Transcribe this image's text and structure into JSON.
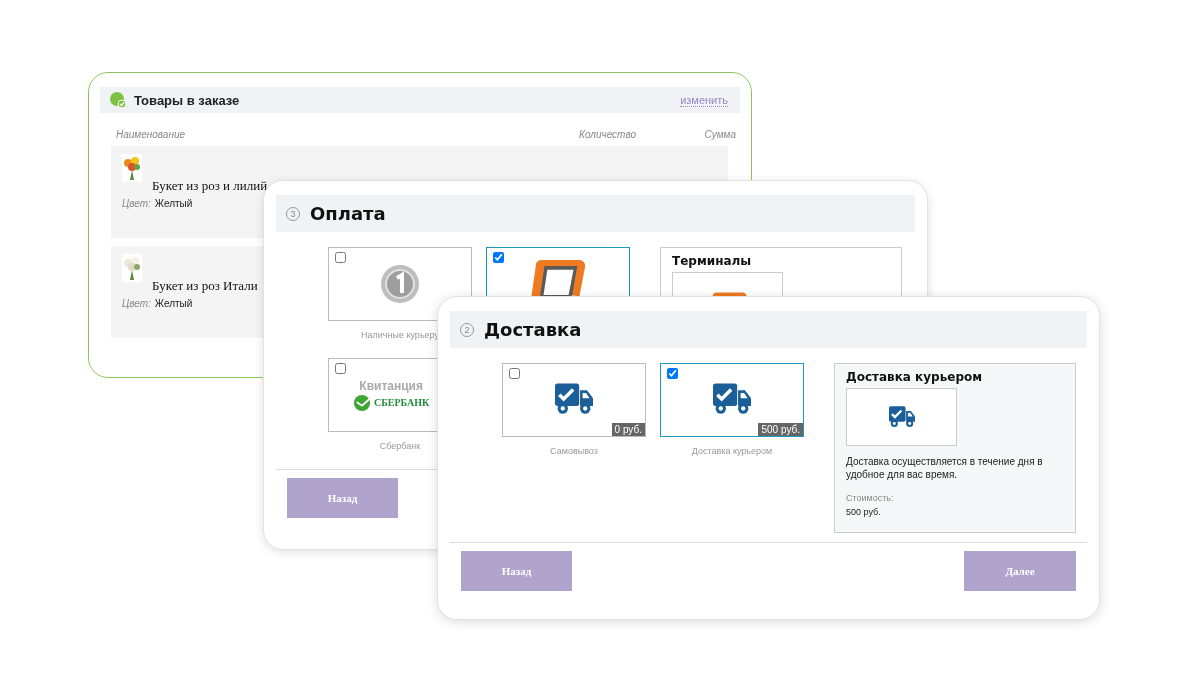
{
  "order_card": {
    "title": "Товары в заказе",
    "edit_link": "изменить",
    "columns": [
      "Наименование",
      "Количество",
      "Сумма"
    ],
    "items": [
      {
        "name": "Букет из роз и лилий",
        "color_label": "Цвет:",
        "color_value": "Желтый",
        "kind": "mixed"
      },
      {
        "name": "Букет из роз Итали",
        "color_label": "Цвет:",
        "color_value": "Желтый",
        "kind": "white"
      }
    ]
  },
  "payment_card": {
    "step": "3",
    "title": "Оплата",
    "options": [
      {
        "kind": "coin",
        "label": "Наличные курьеру",
        "checked": false
      },
      {
        "kind": "terminal",
        "checked": true
      },
      {
        "kind": "sberbank",
        "label": "Сбербанк",
        "checked": false,
        "logo_caption": "Квитанция",
        "logo_text": "СБЕРБАНК"
      }
    ],
    "details": {
      "title": "Терминалы"
    },
    "back_button": "Назад"
  },
  "delivery_card": {
    "step": "2",
    "title": "Доставка",
    "options": [
      {
        "label": "Самовывоз",
        "price": "0 руб.",
        "checked": false
      },
      {
        "label": "Доставка курьером",
        "price": "500 руб.",
        "checked": true
      }
    ],
    "details": {
      "title": "Доставка курьером",
      "description": "Доставка осуществляется в течение дня в удобное для вас время.",
      "cost_label": "Стоимость:",
      "cost_value": "500 руб."
    },
    "back_button": "Назад",
    "next_button": "Далее"
  }
}
